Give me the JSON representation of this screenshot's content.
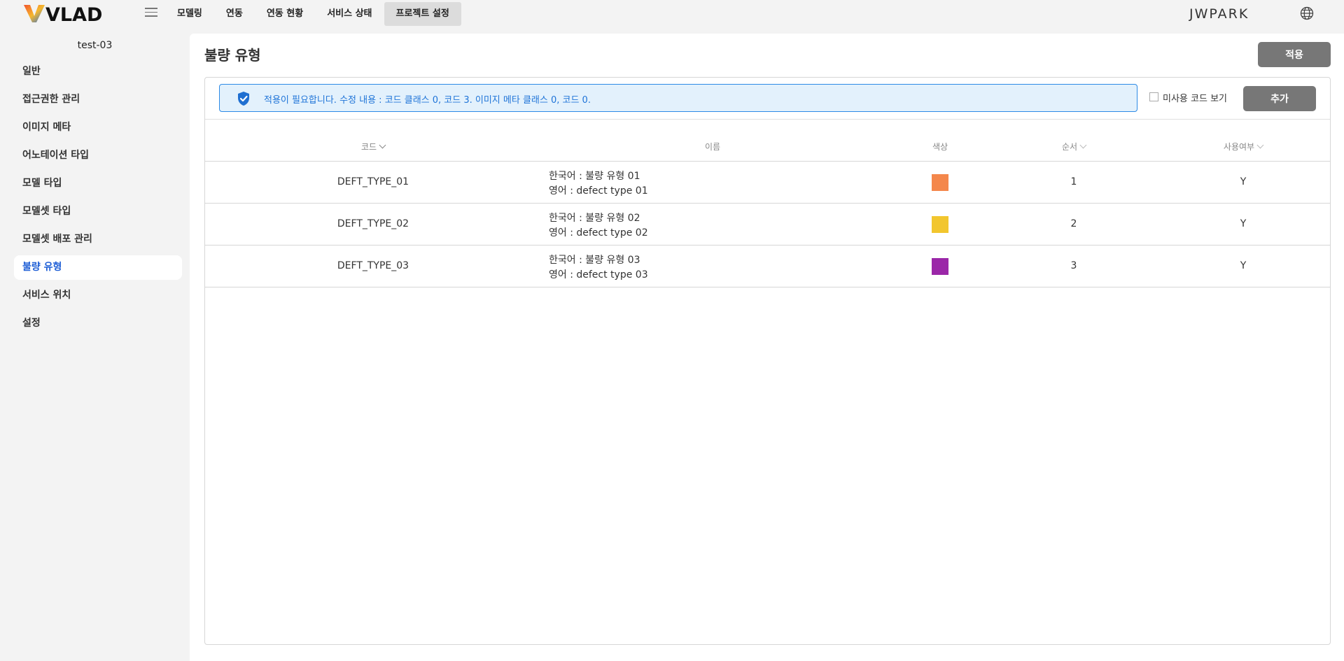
{
  "app": {
    "logo_text": "VLAD"
  },
  "topnav": {
    "items": [
      {
        "label": "모델링"
      },
      {
        "label": "연동"
      },
      {
        "label": "연동 현황"
      },
      {
        "label": "서비스 상태"
      },
      {
        "label": "프로젝트 설정"
      }
    ],
    "active_index": 4
  },
  "user": {
    "name": "JWPARK"
  },
  "sidebar": {
    "project_name": "test-03",
    "items": [
      {
        "label": "일반"
      },
      {
        "label": "접근권한 관리"
      },
      {
        "label": "이미지 메타"
      },
      {
        "label": "어노테이션 타입"
      },
      {
        "label": "모델 타입"
      },
      {
        "label": "모델셋 타입"
      },
      {
        "label": "모델셋 배포 관리"
      },
      {
        "label": "불량 유형"
      },
      {
        "label": "서비스 위치"
      },
      {
        "label": "설정"
      }
    ],
    "active_index": 7
  },
  "page": {
    "title": "불량 유형",
    "apply_label": "적용",
    "alert_text": "적용이 필요합니다. 수정 내용 : 코드 클래스 0, 코드 3. 이미지 메타 클래스 0, 코드 0.",
    "unused_label": "미사용 코드 보기",
    "unused_checked": false,
    "add_label": "추가"
  },
  "table": {
    "columns": {
      "code": "코드",
      "name": "이름",
      "color": "색상",
      "order": "순서",
      "used": "사용여부"
    },
    "rows": [
      {
        "code": "DEFT_TYPE_01",
        "name_ko": "한국어 : 불량 유형 01",
        "name_en": "영어 : defect type 01",
        "color": "#f4874b",
        "order": "1",
        "used": "Y"
      },
      {
        "code": "DEFT_TYPE_02",
        "name_ko": "한국어 : 불량 유형 02",
        "name_en": "영어 : defect type 02",
        "color": "#f2c62e",
        "order": "2",
        "used": "Y"
      },
      {
        "code": "DEFT_TYPE_03",
        "name_ko": "한국어 : 불량 유형 03",
        "name_en": "영어 : defect type 03",
        "color": "#9b27a8",
        "order": "3",
        "used": "Y"
      }
    ]
  },
  "colors": {
    "accent": "#1f74d8",
    "alert_bg": "#e3f1fc",
    "button_bg": "#777777",
    "active_side": "#1f5fd6"
  },
  "icons": {
    "menu": "hamburger-icon",
    "globe": "globe-icon",
    "alert": "shield-check-icon",
    "sort": "chevron-down-icon"
  }
}
